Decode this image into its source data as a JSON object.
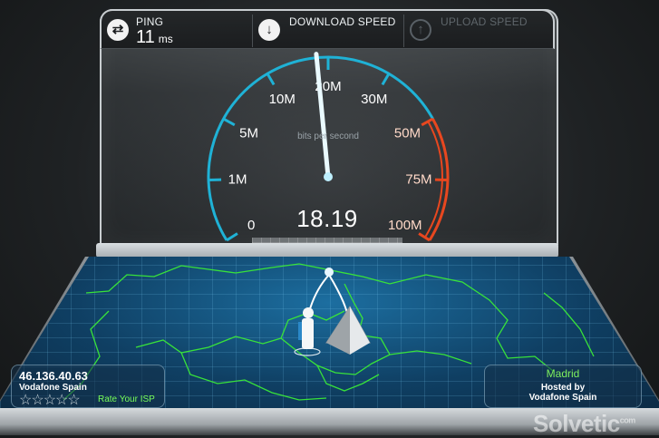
{
  "header": {
    "ping": {
      "label": "PING",
      "value": "11",
      "unit": "ms",
      "icon": "ping-icon"
    },
    "download": {
      "label": "DOWNLOAD SPEED",
      "icon": "download-arrow-icon"
    },
    "upload": {
      "label": "UPLOAD SPEED",
      "icon": "upload-arrow-icon"
    }
  },
  "gauge": {
    "ticks": [
      {
        "label": "0",
        "value": 0
      },
      {
        "label": "1M",
        "value": 1
      },
      {
        "label": "5M",
        "value": 5
      },
      {
        "label": "10M",
        "value": 10
      },
      {
        "label": "20M",
        "value": 20
      },
      {
        "label": "30M",
        "value": 30
      },
      {
        "label": "50M",
        "value": 50
      },
      {
        "label": "75M",
        "value": 75
      },
      {
        "label": "100M",
        "value": 100
      }
    ],
    "unit_label": "bits per second",
    "current_speed": "18.19",
    "needle_value": 18.19,
    "arc_color": "#1fb2d6",
    "high_color": "#e8471f"
  },
  "client": {
    "ip": "46.136.40.63",
    "isp": "Vodafone Spain",
    "stars": "☆☆☆☆☆",
    "rate_label": "Rate Your ISP"
  },
  "server": {
    "city": "Madrid",
    "hosted_by": "Hosted by",
    "host": "Vodafone Spain"
  },
  "watermark": {
    "brand": "Solvetic",
    "suffix": "com"
  }
}
